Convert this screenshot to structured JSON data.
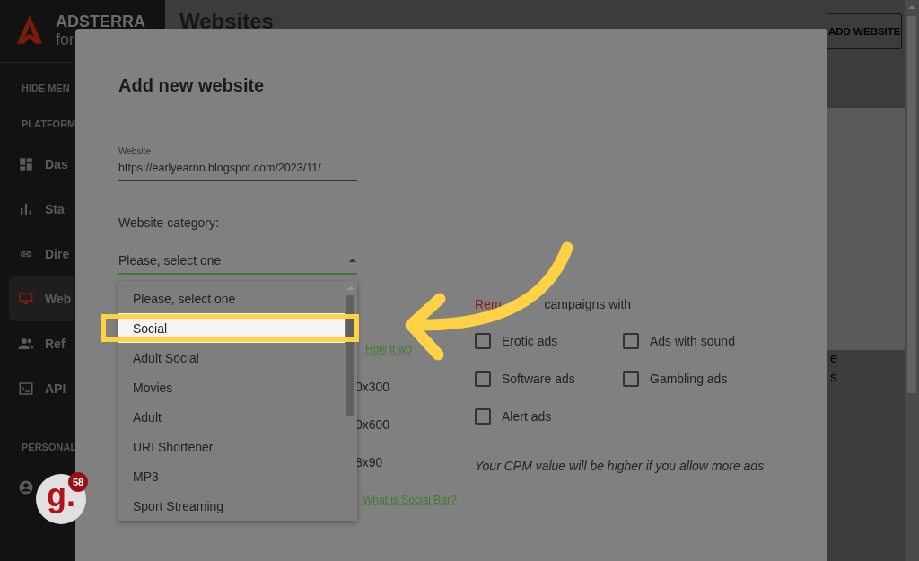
{
  "sidebar": {
    "logo": {
      "name": "ADSTERRA",
      "tagline": "for"
    },
    "hide_menu": "HIDE MEN",
    "sections": [
      {
        "title": "PLATFORM",
        "items": [
          {
            "label": "Das",
            "selected": false
          },
          {
            "label": "Sta",
            "selected": false
          },
          {
            "label": "Dire",
            "selected": false
          },
          {
            "label": "Web",
            "selected": true
          },
          {
            "label": "Ref",
            "selected": false
          },
          {
            "label": "API",
            "selected": false
          }
        ]
      },
      {
        "title": "PERSONAL",
        "items": [
          {
            "selected": false
          }
        ]
      }
    ]
  },
  "header": {
    "title": "Websites",
    "add_button": "ADD WEBSITE"
  },
  "background_fragments": [
    "e",
    "s"
  ],
  "modal": {
    "title": "Add new website",
    "website": {
      "label": "Website",
      "value": "https://earlyearnn.blogspot.com/2023/11/"
    },
    "category": {
      "label": "Website category:",
      "value": "Please, select one",
      "open": true
    },
    "dropdown": [
      {
        "label": "Please, select one",
        "selected": false
      },
      {
        "label": "Social",
        "selected": true
      },
      {
        "label": "Adult Social",
        "selected": false
      },
      {
        "label": "Movies",
        "selected": false
      },
      {
        "label": "Adult",
        "selected": false
      },
      {
        "label": "URLShortener",
        "selected": false
      },
      {
        "label": "MP3",
        "selected": false
      },
      {
        "label": "Sport Streaming",
        "selected": false
      }
    ],
    "ad_formats": {
      "link": "How it wo",
      "sizes": [
        "0x300",
        "0x600",
        "8x90"
      ],
      "social_link": "What is Social Bar?"
    },
    "remove": {
      "highlight": "Rem",
      "text": "campaigns with",
      "options": [
        {
          "label": "Erotic ads",
          "checked": false
        },
        {
          "label": "Ads with sound",
          "checked": false
        },
        {
          "label": "Software ads",
          "checked": false
        },
        {
          "label": "Gambling ads",
          "checked": false
        },
        {
          "label": "Alert ads",
          "checked": false
        }
      ],
      "note": "Your CPM value will be higher if you allow more ads"
    }
  },
  "extension": {
    "label": "g.",
    "badge": "58"
  }
}
